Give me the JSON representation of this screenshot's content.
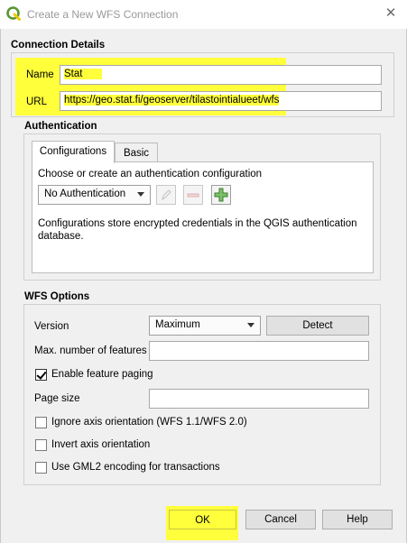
{
  "window": {
    "title": "Create a New WFS Connection",
    "close_glyph": "✕"
  },
  "connection": {
    "heading": "Connection Details",
    "name_label": "Name",
    "name_value": "Stat",
    "url_label": "URL",
    "url_value": "https://geo.stat.fi/geoserver/tilastointialueet/wfs"
  },
  "auth": {
    "heading": "Authentication",
    "tabs": [
      "Configurations",
      "Basic"
    ],
    "choose_text": "Choose or create an authentication configuration",
    "selected": "No Authentication",
    "info_text": "Configurations store encrypted credentials in the QGIS authentication database."
  },
  "wfs": {
    "heading": "WFS Options",
    "version_label": "Version",
    "version_value": "Maximum",
    "detect_label": "Detect",
    "max_features_label": "Max. number of features",
    "max_features_value": "",
    "paging_label": "Enable feature paging",
    "paging_checked": true,
    "page_size_label": "Page size",
    "page_size_value": "",
    "ignore_axis_label": "Ignore axis orientation (WFS 1.1/WFS 2.0)",
    "invert_axis_label": "Invert axis orientation",
    "gml2_label": "Use GML2 encoding for transactions"
  },
  "buttons": {
    "ok": "OK",
    "cancel": "Cancel",
    "help": "Help"
  },
  "colors": {
    "highlight": "#ffff3c",
    "qgis_green": "#589632",
    "qgis_yellow": "#eec900"
  }
}
